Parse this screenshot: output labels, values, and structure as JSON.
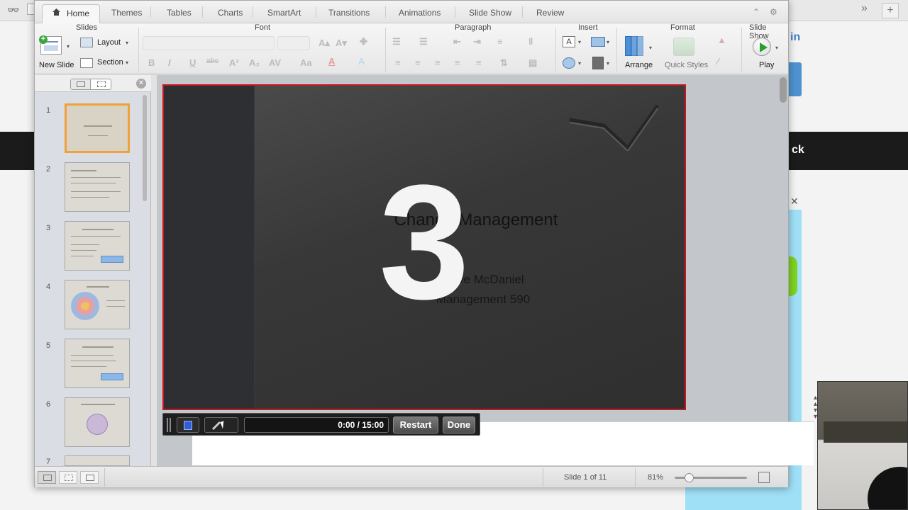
{
  "window": {
    "tabs": [
      {
        "label": "Home",
        "active": true
      },
      {
        "label": "Themes"
      },
      {
        "label": "Tables"
      },
      {
        "label": "Charts"
      },
      {
        "label": "SmartArt"
      },
      {
        "label": "Transitions"
      },
      {
        "label": "Animations"
      },
      {
        "label": "Slide Show"
      },
      {
        "label": "Review"
      }
    ]
  },
  "ribbon": {
    "groups": {
      "slides": "Slides",
      "font": "Font",
      "paragraph": "Paragraph",
      "insert": "Insert",
      "format": "Format",
      "slide_show": "Slide Show"
    },
    "new_slide": "New Slide",
    "layout": "Layout",
    "section": "Section",
    "arrange": "Arrange",
    "quick_styles": "Quick Styles",
    "play": "Play"
  },
  "thumbnails": {
    "numbers": [
      "1",
      "2",
      "3",
      "4",
      "5",
      "6",
      "7"
    ],
    "selected": "1"
  },
  "slide": {
    "title": "Change Management",
    "subtitle_line1": "Dave McDaniel",
    "subtitle_line2": "Management 590",
    "countdown": "3"
  },
  "recording_bar": {
    "time": "0:00 / 15:00",
    "restart_label": "Restart",
    "done_label": "Done"
  },
  "status": {
    "slide_counter": "Slide 1 of 11",
    "zoom": "81%",
    "zoom_fraction": 0.2
  },
  "background": {
    "dark_band_text": "ck",
    "in_text": "in"
  },
  "colors": {
    "accent_red": "#c8161d",
    "selection_orange": "#f0a13a",
    "play_green": "#28a02a"
  }
}
